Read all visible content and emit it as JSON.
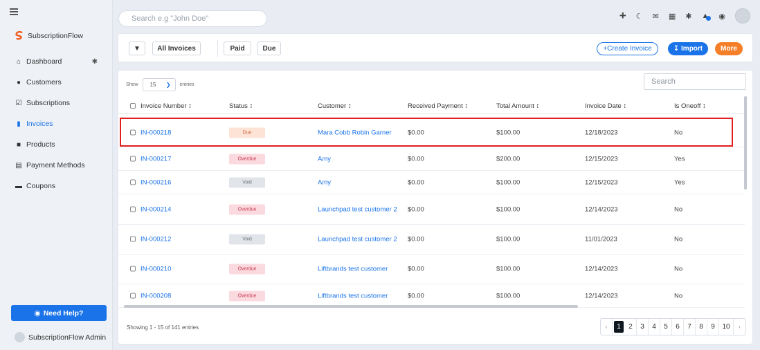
{
  "sidebar": {
    "brand": "SubscriptionFlow",
    "items": [
      {
        "label": "Dashboard",
        "icon": "home-icon"
      },
      {
        "label": "Customers",
        "icon": "users-icon"
      },
      {
        "label": "Subscriptions",
        "icon": "calendar-check-icon"
      },
      {
        "label": "Invoices",
        "icon": "file-icon"
      },
      {
        "label": "Products",
        "icon": "box-icon"
      },
      {
        "label": "Payment Methods",
        "icon": "card-icon"
      },
      {
        "label": "Coupons",
        "icon": "ticket-icon"
      }
    ],
    "help_label": "Need Help?",
    "admin_name": "SubscriptionFlow Admin"
  },
  "topbar": {
    "search_placeholder": "Search e.g \"John Doe\""
  },
  "filters": {
    "all_invoices": "All Invoices",
    "paid": "Paid",
    "due": "Due",
    "create_invoice": "+Create Invoice",
    "import": "Import",
    "more": "More"
  },
  "table": {
    "show_label": "Show",
    "entries_value": "15",
    "entries_label": "entries",
    "search_placeholder": "Search",
    "headers": {
      "invoice_number": "Invoice Number ↕",
      "status": "Status ↕",
      "customer": "Customer ↕",
      "received_payment": "Received Payment ↕",
      "total_amount": "Total Amount ↕",
      "invoice_date": "Invoice Date ↕",
      "is_oneoff": "Is Oneoff ↕"
    },
    "rows": [
      {
        "num": "IN-000218",
        "status": "Due",
        "customer": "Mara Cobb Robin Garner",
        "received": "$0.00",
        "total": "$100.00",
        "date": "12/18/2023",
        "oneoff": "No"
      },
      {
        "num": "IN-000217",
        "status": "Overdue",
        "customer": "Amy",
        "received": "$0.00",
        "total": "$200.00",
        "date": "12/15/2023",
        "oneoff": "Yes"
      },
      {
        "num": "IN-000216",
        "status": "Void",
        "customer": "Amy",
        "received": "$0.00",
        "total": "$100.00",
        "date": "12/15/2023",
        "oneoff": "Yes"
      },
      {
        "num": "IN-000214",
        "status": "Overdue",
        "customer": "Launchpad test customer 2",
        "received": "$0.00",
        "total": "$100.00",
        "date": "12/14/2023",
        "oneoff": "No"
      },
      {
        "num": "IN-000212",
        "status": "Void",
        "customer": "Launchpad test customer 2",
        "received": "$0.00",
        "total": "$100.00",
        "date": "11/01/2023",
        "oneoff": "No"
      },
      {
        "num": "IN-000210",
        "status": "Overdue",
        "customer": "Liftbrands test customer",
        "received": "$0.00",
        "total": "$100.00",
        "date": "12/14/2023",
        "oneoff": "No"
      },
      {
        "num": "IN-000208",
        "status": "Overdue",
        "customer": "Liftbrands test customer",
        "received": "$0.00",
        "total": "$100.00",
        "date": "12/14/2023",
        "oneoff": "No"
      }
    ],
    "footer_info": "Showing 1 - 15 of 141 entries",
    "pages": [
      "1",
      "2",
      "3",
      "4",
      "5",
      "6",
      "7",
      "8",
      "9",
      "10"
    ],
    "prev": "‹",
    "next": "›"
  }
}
